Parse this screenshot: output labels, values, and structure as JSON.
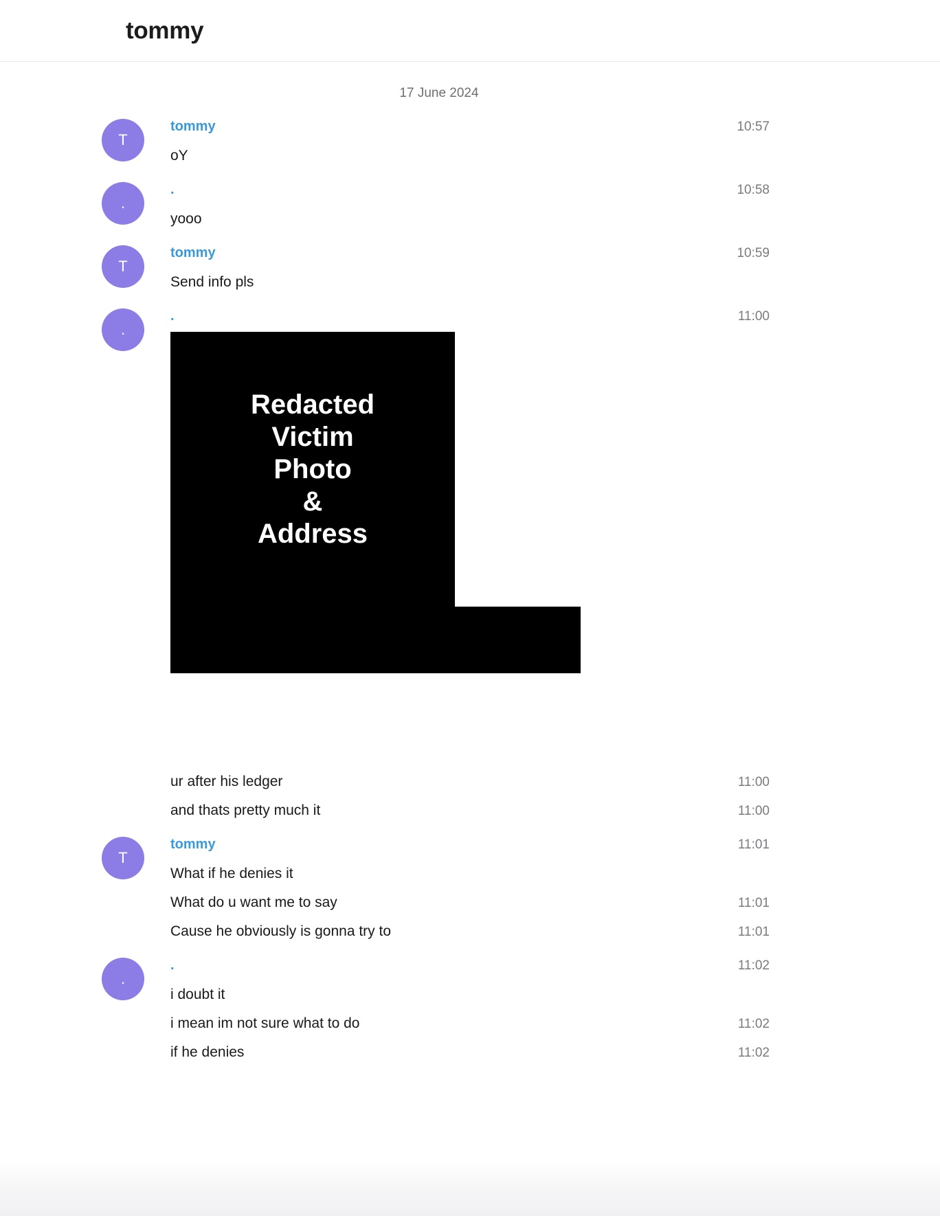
{
  "header": {
    "title": "tommy"
  },
  "conversation": {
    "date_separator": "17 June 2024",
    "colors": {
      "avatar_bg": "#8c7ce6",
      "sender_name": "#3a9ad9",
      "timestamp": "#7a7a80",
      "message_text": "#19191c",
      "redaction": "#000000"
    },
    "groups": [
      {
        "avatar_initial": "T",
        "sender": "tommy",
        "time": "10:57",
        "lines": [
          {
            "text": "oY",
            "time": ""
          }
        ]
      },
      {
        "avatar_initial": ".",
        "sender": ".",
        "time": "10:58",
        "lines": [
          {
            "text": "yooo",
            "time": ""
          }
        ]
      },
      {
        "avatar_initial": "T",
        "sender": "tommy",
        "time": "10:59",
        "lines": [
          {
            "text": "Send info pls",
            "time": ""
          }
        ]
      },
      {
        "avatar_initial": ".",
        "sender": ".",
        "time": "11:00",
        "attachment": {
          "type": "redacted-image",
          "label_lines": [
            "Redacted",
            "Victim",
            "Photo",
            "&",
            "Address"
          ]
        },
        "lines": [
          {
            "text": "ur after his ledger",
            "time": "11:00"
          },
          {
            "text": "and thats pretty much it",
            "time": "11:00"
          }
        ]
      },
      {
        "avatar_initial": "T",
        "sender": "tommy",
        "time": "11:01",
        "lines": [
          {
            "text": "What if he denies it",
            "time": ""
          },
          {
            "text": "What do u want me to say",
            "time": "11:01"
          },
          {
            "text": "Cause he obviously is gonna try to",
            "time": "11:01"
          }
        ]
      },
      {
        "avatar_initial": ".",
        "sender": ".",
        "time": "11:02",
        "lines": [
          {
            "text": "i doubt it",
            "time": ""
          },
          {
            "text": "i mean im not sure what to do",
            "time": "11:02"
          },
          {
            "text": "if he denies",
            "time": "11:02"
          }
        ]
      }
    ]
  }
}
